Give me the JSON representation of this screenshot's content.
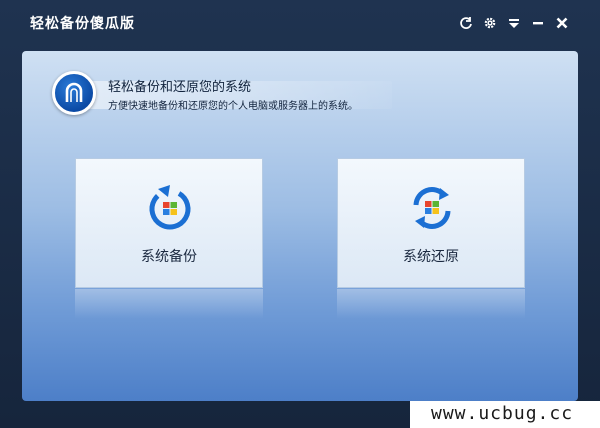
{
  "window": {
    "title": "轻松备份傻瓜版",
    "controls": {
      "refresh_icon": "refresh-icon",
      "settings_icon": "gear-icon",
      "menu_icon": "menu-dropdown-icon",
      "minimize_icon": "minimize-icon",
      "close_icon": "close-icon"
    }
  },
  "header": {
    "title": "轻松备份和还原您的系统",
    "subtitle": "方便快速地备份和还原您的个人电脑或服务器上的系统。"
  },
  "actions": {
    "backup": {
      "label": "系统备份",
      "icon": "backup-icon"
    },
    "restore": {
      "label": "系统还原",
      "icon": "restore-icon"
    }
  },
  "watermark": {
    "text": "www.ucbug.cc"
  },
  "colors": {
    "accent_blue": "#1a6fd0",
    "panel_top": "#cfe0f3",
    "panel_bottom": "#4d7fc8",
    "titlebar": "#1f3350"
  }
}
